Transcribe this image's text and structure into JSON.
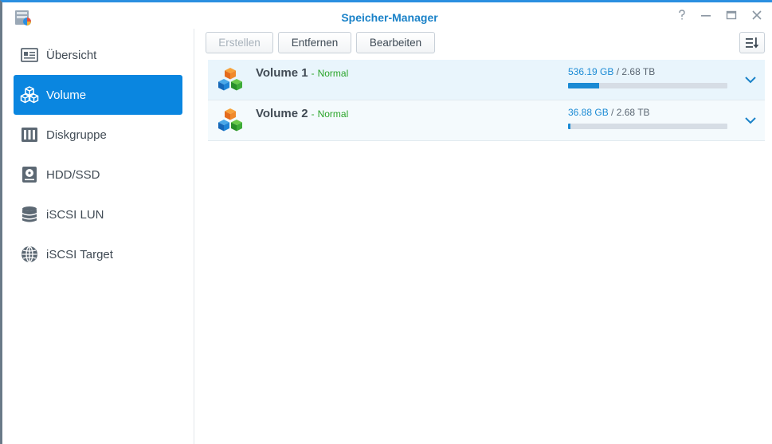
{
  "window": {
    "title": "Speicher-Manager",
    "controls": [
      "help-icon",
      "minimize-icon",
      "maximize-icon",
      "close-icon"
    ]
  },
  "sidebar": {
    "items": [
      {
        "label": "Übersicht",
        "icon": "overview-icon",
        "active": false
      },
      {
        "label": "Volume",
        "icon": "volume-cubes-icon",
        "active": true
      },
      {
        "label": "Diskgruppe",
        "icon": "diskgroup-icon",
        "active": false
      },
      {
        "label": "HDD/SSD",
        "icon": "hdd-icon",
        "active": false
      },
      {
        "label": "iSCSI LUN",
        "icon": "database-icon",
        "active": false
      },
      {
        "label": "iSCSI Target",
        "icon": "globe-icon",
        "active": false
      }
    ]
  },
  "toolbar": {
    "create_label": "Erstellen",
    "remove_label": "Entfernen",
    "edit_label": "Bearbeiten",
    "sort_icon": "sort-icon"
  },
  "volumes": [
    {
      "name": "Volume 1",
      "separator": "-",
      "status": "Normal",
      "used": "536.19 GB",
      "slash": "/",
      "total": "2.68 TB",
      "usage_fraction": 0.195
    },
    {
      "name": "Volume 2",
      "separator": "-",
      "status": "Normal",
      "used": "36.88 GB",
      "slash": "/",
      "total": "2.68 TB",
      "usage_fraction": 0.013
    }
  ],
  "colors": {
    "accent": "#0a86e0",
    "status_ok": "#2aa52a",
    "title": "#1a82c8"
  }
}
